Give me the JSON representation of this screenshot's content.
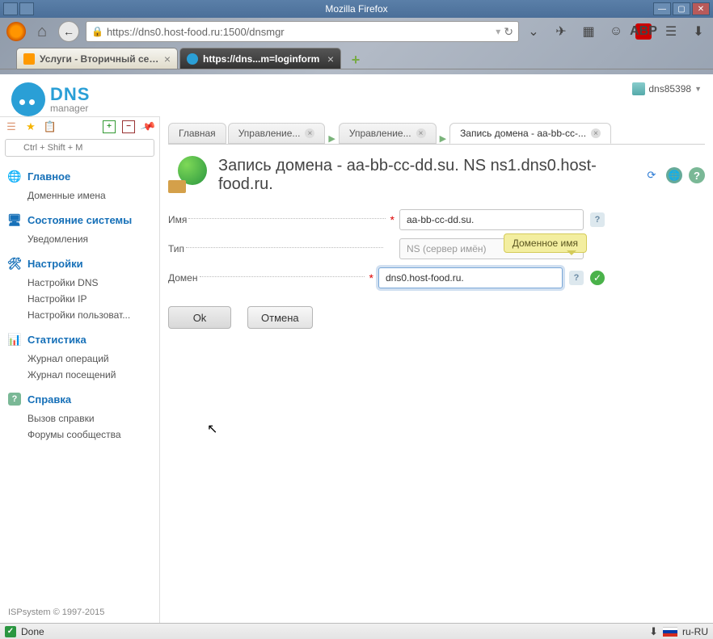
{
  "window": {
    "title": "Mozilla Firefox"
  },
  "browser": {
    "url": "https://dns0.host-food.ru:1500/dnsmgr",
    "tabs": [
      {
        "label": "Услуги - Вторичный сервер...",
        "active": false
      },
      {
        "label": "https://dns...m=loginform",
        "active": true
      }
    ]
  },
  "user": {
    "name": "dns85398"
  },
  "logo": {
    "line1": "DNS",
    "line2": "manager"
  },
  "sidebar": {
    "search_placeholder": "Ctrl + Shift + M",
    "sections": [
      {
        "title": "Главное",
        "icon": "globe",
        "items": [
          "Доменные имена"
        ]
      },
      {
        "title": "Состояние системы",
        "icon": "monitor",
        "items": [
          "Уведомления"
        ]
      },
      {
        "title": "Настройки",
        "icon": "gear",
        "items": [
          "Настройки DNS",
          "Настройки IP",
          "Настройки пользоват..."
        ]
      },
      {
        "title": "Статистика",
        "icon": "chart",
        "items": [
          "Журнал операций",
          "Журнал посещений"
        ]
      },
      {
        "title": "Справка",
        "icon": "help",
        "items": [
          "Вызов справки",
          "Форумы сообщества"
        ]
      }
    ]
  },
  "page_tabs": [
    {
      "label": "Главная",
      "closable": false
    },
    {
      "label": "Управление...",
      "closable": true
    },
    {
      "label": "Управление...",
      "closable": true
    },
    {
      "label": "Запись домена - aa-bb-cc-...",
      "closable": true,
      "active": true
    }
  ],
  "page": {
    "title": "Запись домена - aa-bb-cc-dd.su. NS ns1.dns0.host-food.ru."
  },
  "form": {
    "name_label": "Имя",
    "name_value": "aa-bb-cc-dd.su.",
    "type_label": "Тип",
    "type_value": "NS (сервер имён)",
    "domain_label": "Домен",
    "domain_value": "dns0.host-food.ru.",
    "tooltip": "Доменное имя",
    "ok": "Ok",
    "cancel": "Отмена"
  },
  "footer": {
    "copyright": "ISPsystem © 1997-2015"
  },
  "statusbar": {
    "status": "Done",
    "lang": "ru-RU"
  }
}
